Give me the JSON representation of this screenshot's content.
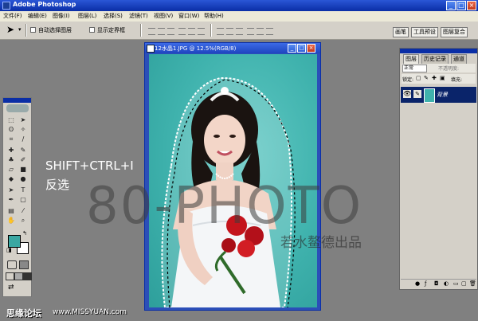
{
  "window": {
    "title": "Adobe Photoshop",
    "controls": [
      "_",
      "□",
      "×"
    ]
  },
  "menu": [
    "文件(F)",
    "编辑(E)",
    "图像(I)",
    "图层(L)",
    "选择(S)",
    "滤镜(T)",
    "视图(V)",
    "窗口(W)",
    "帮助(H)"
  ],
  "options_bar": {
    "auto_select_layer": "自动选择图层",
    "show_bounding_box": "显示定界框",
    "palette_tabs": [
      "画笔",
      "工具预设",
      "图层复合"
    ]
  },
  "document": {
    "title": "12水晶1.JPG @ 12.5%(RGB/8)"
  },
  "layers_panel": {
    "tabs": [
      "图层",
      "历史记录",
      "通道"
    ],
    "blend_mode": "正常",
    "opacity_label": "不透明度:",
    "lock_label": "锁定:",
    "fill_label": "填充:",
    "layer_name": "背景"
  },
  "overlay": {
    "shortcut": "SHIFT+CTRL+I",
    "action": "反选",
    "watermark": "80-PHOTO",
    "watermark_sub": "若水鳌德出品",
    "site_name": "思缘论坛",
    "site_url": "www.MISSYUAN.com"
  },
  "colors": {
    "titlebar": "#0a2ea6",
    "chrome": "#d4d0c8",
    "workspace": "#808080",
    "photo_background": "#3fb2ad",
    "foreground_swatch": "#3aa7a2",
    "background_swatch": "#ffffff",
    "selected_layer": "#0a246a"
  }
}
